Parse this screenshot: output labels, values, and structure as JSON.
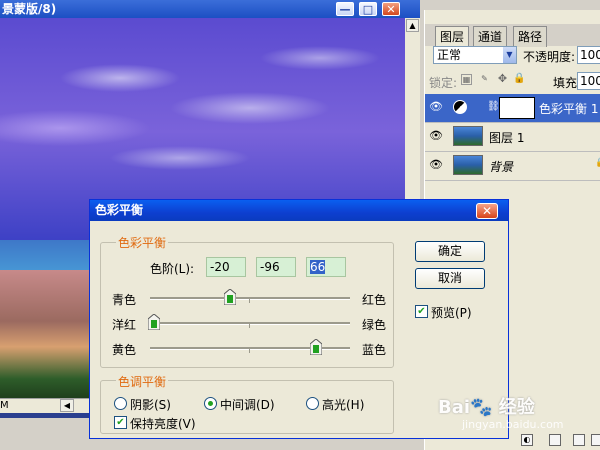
{
  "document": {
    "title": "景蒙版/8)",
    "zoom": "M",
    "buttons": {
      "minimize": "—",
      "maximize": "□",
      "close": "✕"
    }
  },
  "layers_panel": {
    "tabs": [
      "图层",
      "通道",
      "路径"
    ],
    "blend_mode": "正常",
    "opacity_label": "不透明度:",
    "opacity_value": "100",
    "lock_label": "锁定:",
    "fill_label": "填充:",
    "fill_value": "100",
    "layers": [
      {
        "name": "色彩平衡 1",
        "selected": true
      },
      {
        "name": "图层 1",
        "selected": false
      },
      {
        "name": "背景",
        "selected": false
      }
    ]
  },
  "dialog": {
    "title": "色彩平衡",
    "balance_group_title": "色彩平衡",
    "levels_label": "色阶(L):",
    "levels": [
      "-20",
      "-96",
      "66"
    ],
    "sliders": [
      {
        "left": "青色",
        "right": "红色",
        "value": -20
      },
      {
        "left": "洋红",
        "right": "绿色",
        "value": -96
      },
      {
        "left": "黄色",
        "right": "蓝色",
        "value": 66
      }
    ],
    "ok_label": "确定",
    "cancel_label": "取消",
    "preview_label": "预览(P)",
    "preview_checked": true,
    "tone_group_title": "色调平衡",
    "tones": [
      {
        "label": "阴影(S)",
        "selected": false
      },
      {
        "label": "中间调(D)",
        "selected": true
      },
      {
        "label": "高光(H)",
        "selected": false
      }
    ],
    "preserve_label": "保持亮度(V)",
    "preserve_checked": true
  },
  "watermark": {
    "text": "Bai🐾 经验",
    "url": "jingyan.baidu.com"
  },
  "colors": {
    "accent": "#e06a10",
    "titlebar": "#0a5ff0",
    "slider_knob": "#21a121"
  }
}
